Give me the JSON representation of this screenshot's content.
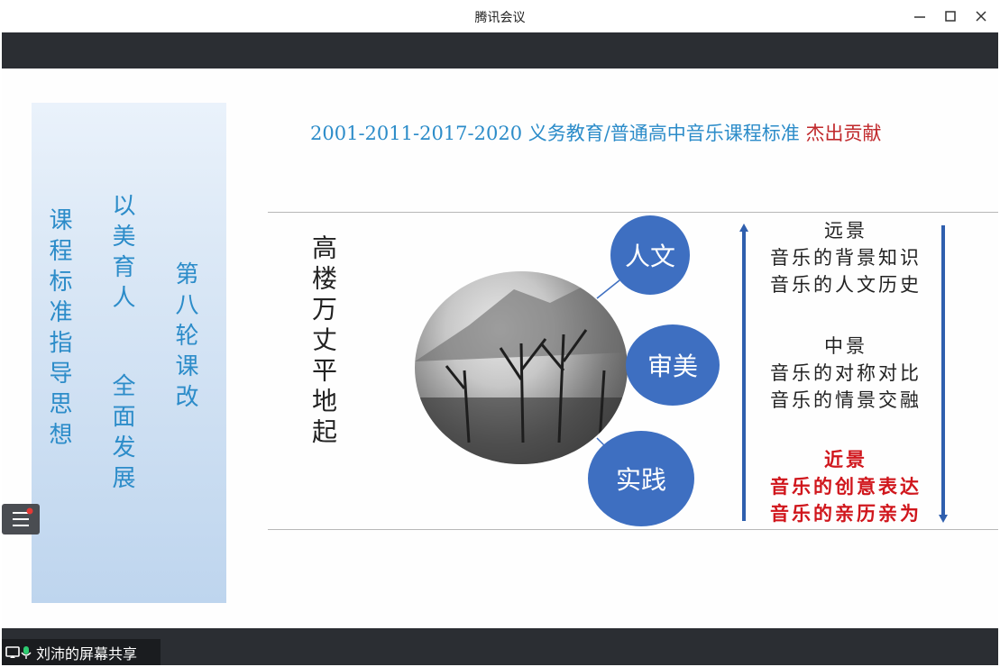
{
  "window": {
    "title": "腾讯会议"
  },
  "share": {
    "label": "刘沛的屏幕共享"
  },
  "slide": {
    "left_columns": [
      "课程标准指导思想",
      "以美育人",
      "全面发展",
      "第八轮课改"
    ],
    "headline_main": "2001-2011-2017-2020 义务教育/普通高中音乐课程标准",
    "headline_red": "杰出贡献",
    "poem": "高楼万丈平地起",
    "circles": [
      "人文",
      "审美",
      "实践"
    ],
    "far": {
      "title": "远景",
      "line1": "音乐的背景知识",
      "line2": "音乐的人文历史"
    },
    "mid": {
      "title": "中景",
      "line1": "音乐的对称对比",
      "line2": "音乐的情景交融"
    },
    "near": {
      "title": "近景",
      "line1": "音乐的创意表达",
      "line2": "音乐的亲历亲为"
    }
  },
  "colors": {
    "accent_blue": "#3e6fc1",
    "title_blue": "#2c8cc9",
    "red": "#d0161c",
    "bar": "#2b2e33"
  },
  "icons": [
    "minimize-icon",
    "maximize-icon",
    "close-icon",
    "screen-share-icon",
    "microphone-icon",
    "list-icon"
  ]
}
